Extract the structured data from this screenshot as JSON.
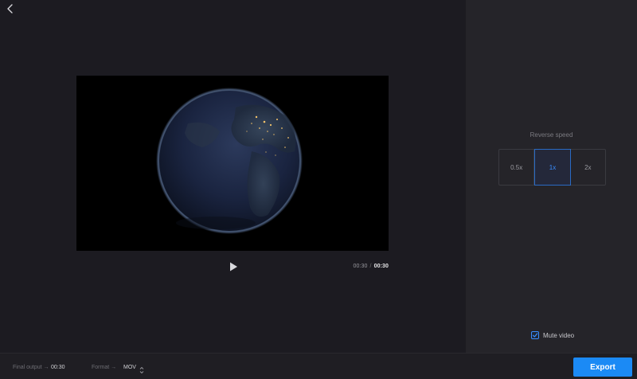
{
  "header": {
    "back_icon": "chevron-left-icon"
  },
  "player": {
    "play_icon": "play-icon",
    "current_time": "00:30",
    "separator": "/",
    "total_time": "00:30"
  },
  "sidebar": {
    "speed_title": "Reverse speed",
    "speed_options": [
      {
        "label": "0.5x",
        "active": false
      },
      {
        "label": "1x",
        "active": true
      },
      {
        "label": "2x",
        "active": false
      }
    ],
    "mute_label": "Mute video",
    "mute_checked": true
  },
  "footer": {
    "final_output_label": "Final output →",
    "final_output_value": "00:30",
    "format_label": "Format →",
    "format_value": "MOV",
    "export_label": "Export"
  },
  "colors": {
    "accent": "#1b8af5",
    "active_text": "#3a8dff",
    "background": "#1c1b21",
    "panel": "#252429"
  }
}
